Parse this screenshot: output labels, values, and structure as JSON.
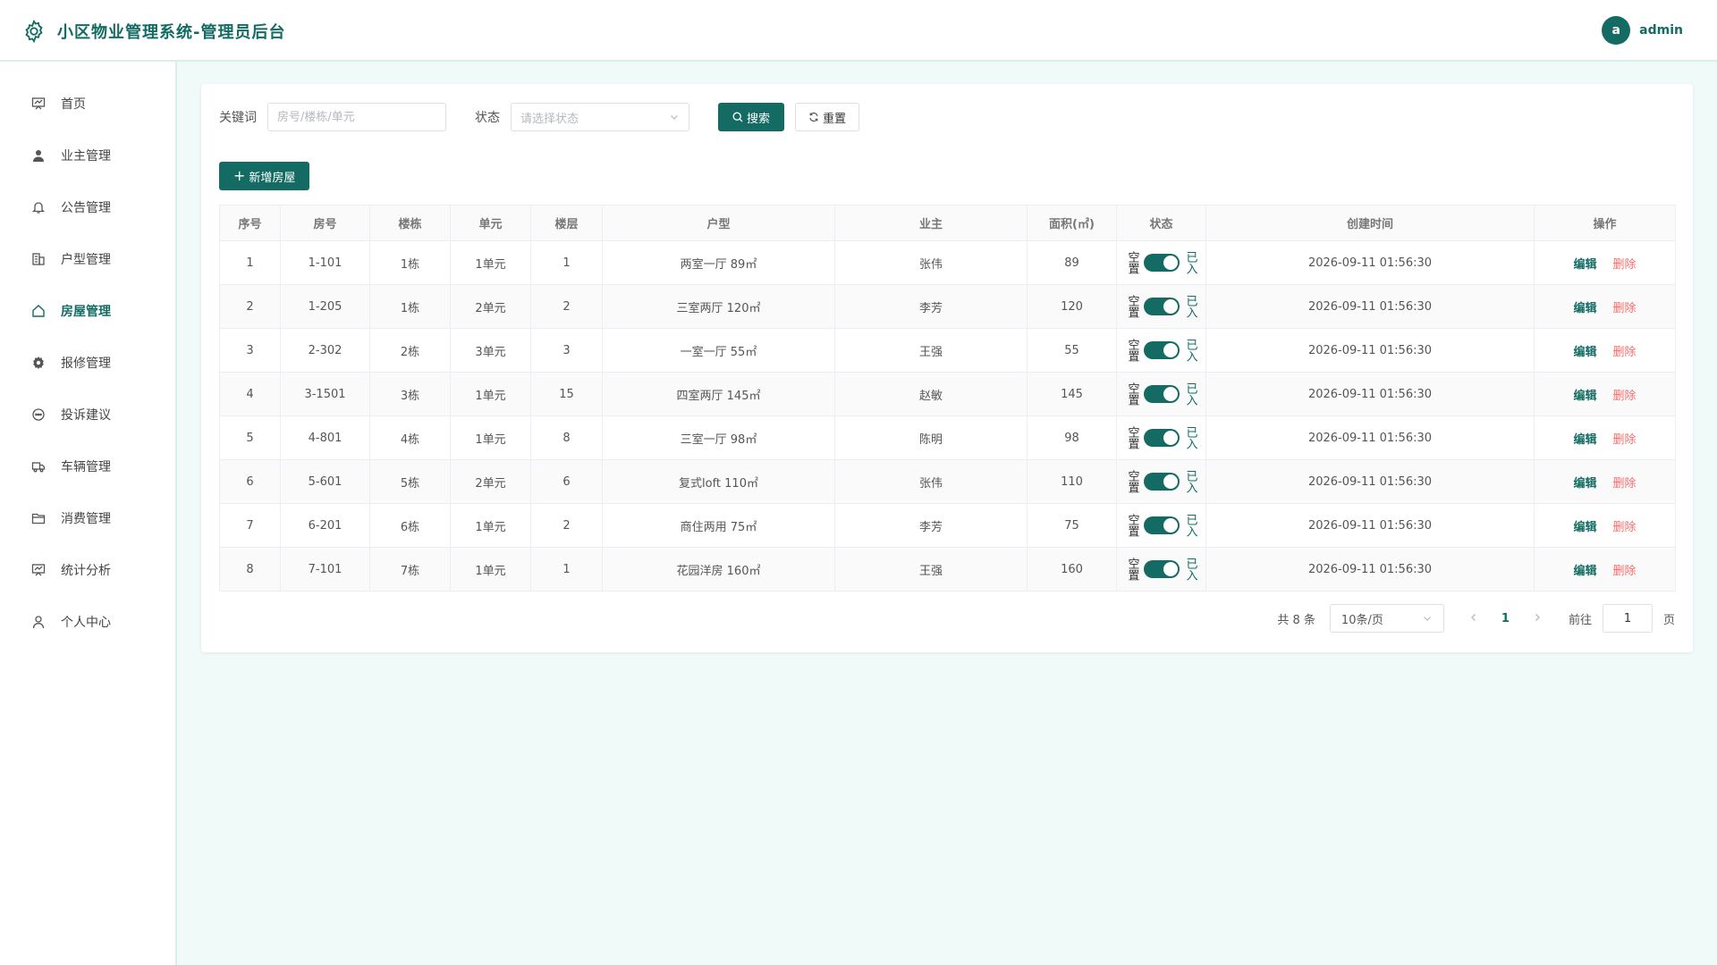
{
  "header": {
    "title": "小区物业管理系统-管理员后台",
    "avatar_letter": "a",
    "username": "admin"
  },
  "sidebar": {
    "items": [
      {
        "label": "首页",
        "icon": "dashboard-icon"
      },
      {
        "label": "业主管理",
        "icon": "user-icon"
      },
      {
        "label": "公告管理",
        "icon": "bell-icon"
      },
      {
        "label": "户型管理",
        "icon": "building-icon"
      },
      {
        "label": "房屋管理",
        "icon": "house-icon"
      },
      {
        "label": "报修管理",
        "icon": "gear-icon"
      },
      {
        "label": "投诉建议",
        "icon": "chat-icon"
      },
      {
        "label": "车辆管理",
        "icon": "truck-icon"
      },
      {
        "label": "消费管理",
        "icon": "folder-icon"
      },
      {
        "label": "统计分析",
        "icon": "chart-icon"
      },
      {
        "label": "个人中心",
        "icon": "person-icon"
      }
    ],
    "active_index": 4
  },
  "filters": {
    "keyword_label": "关键词",
    "keyword_placeholder": "房号/楼栋/单元",
    "keyword_value": "",
    "status_label": "状态",
    "status_placeholder": "请选择状态",
    "search_label": "搜索",
    "reset_label": "重置"
  },
  "add_button_label": "新增房屋",
  "table": {
    "columns": [
      "序号",
      "房号",
      "楼栋",
      "单元",
      "楼层",
      "户型",
      "业主",
      "面积(㎡)",
      "状态",
      "创建时间",
      "操作"
    ],
    "switch_off_text": "空置",
    "switch_on_text": "已入",
    "edit_label": "编辑",
    "delete_label": "删除",
    "rows": [
      {
        "no": "1",
        "room": "1-101",
        "building": "1栋",
        "unit": "1单元",
        "floor": "1",
        "type": "两室一厅 89㎡",
        "owner": "张伟",
        "area": "89",
        "occupied": true,
        "created": "2026-09-11 01:56:30"
      },
      {
        "no": "2",
        "room": "1-205",
        "building": "1栋",
        "unit": "2单元",
        "floor": "2",
        "type": "三室两厅 120㎡",
        "owner": "李芳",
        "area": "120",
        "occupied": true,
        "created": "2026-09-11 01:56:30"
      },
      {
        "no": "3",
        "room": "2-302",
        "building": "2栋",
        "unit": "3单元",
        "floor": "3",
        "type": "一室一厅 55㎡",
        "owner": "王强",
        "area": "55",
        "occupied": true,
        "created": "2026-09-11 01:56:30"
      },
      {
        "no": "4",
        "room": "3-1501",
        "building": "3栋",
        "unit": "1单元",
        "floor": "15",
        "type": "四室两厅 145㎡",
        "owner": "赵敏",
        "area": "145",
        "occupied": true,
        "created": "2026-09-11 01:56:30"
      },
      {
        "no": "5",
        "room": "4-801",
        "building": "4栋",
        "unit": "1单元",
        "floor": "8",
        "type": "三室一厅 98㎡",
        "owner": "陈明",
        "area": "98",
        "occupied": true,
        "created": "2026-09-11 01:56:30"
      },
      {
        "no": "6",
        "room": "5-601",
        "building": "5栋",
        "unit": "2单元",
        "floor": "6",
        "type": "复式loft 110㎡",
        "owner": "张伟",
        "area": "110",
        "occupied": true,
        "created": "2026-09-11 01:56:30"
      },
      {
        "no": "7",
        "room": "6-201",
        "building": "6栋",
        "unit": "1单元",
        "floor": "2",
        "type": "商住两用 75㎡",
        "owner": "李芳",
        "area": "75",
        "occupied": true,
        "created": "2026-09-11 01:56:30"
      },
      {
        "no": "8",
        "room": "7-101",
        "building": "7栋",
        "unit": "1单元",
        "floor": "1",
        "type": "花园洋房 160㎡",
        "owner": "王强",
        "area": "160",
        "occupied": true,
        "created": "2026-09-11 01:56:30"
      }
    ]
  },
  "pagination": {
    "total_text": "共 8 条",
    "page_size": "10条/页",
    "current_page": "1",
    "goto_label": "前往",
    "goto_value": "1",
    "page_unit": "页"
  },
  "colors": {
    "primary": "#136b63",
    "danger": "#f56c6c",
    "background": "#f0faf8"
  }
}
